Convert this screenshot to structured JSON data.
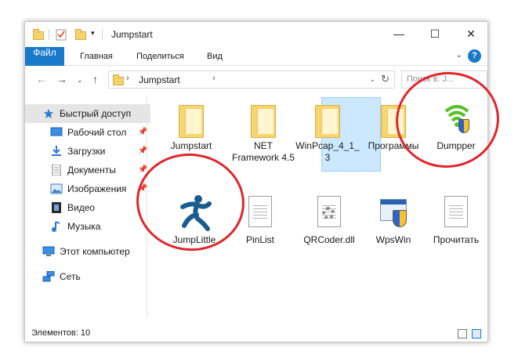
{
  "window": {
    "title": "Jumpstart",
    "controls": {
      "minimize": "—",
      "maximize": "☐",
      "close": "✕"
    }
  },
  "ribbon": {
    "tabs": [
      "Файл",
      "Главная",
      "Поделиться",
      "Вид"
    ],
    "help": "?"
  },
  "navigation": {
    "address_path": "Jumpstart",
    "search_placeholder": "Поиск в: J..."
  },
  "sidebar": {
    "items": [
      {
        "label": "Быстрый доступ",
        "icon": "star-icon",
        "selected": true
      },
      {
        "label": "Рабочий стол",
        "icon": "desktop-icon",
        "pinned": true
      },
      {
        "label": "Загрузки",
        "icon": "download-icon",
        "pinned": true
      },
      {
        "label": "Документы",
        "icon": "documents-icon",
        "pinned": true
      },
      {
        "label": "Изображения",
        "icon": "pictures-icon",
        "pinned": true
      },
      {
        "label": "Видео",
        "icon": "video-icon"
      },
      {
        "label": "Музыка",
        "icon": "music-icon"
      },
      {
        "label": "Этот компьютер",
        "icon": "computer-icon"
      },
      {
        "label": "Сеть",
        "icon": "network-icon"
      }
    ]
  },
  "files": [
    {
      "name": "Jumpstart",
      "type": "folder"
    },
    {
      "name": "NET Framework 4.5",
      "type": "folder"
    },
    {
      "name": "WinPcap_4_1_3",
      "type": "folder"
    },
    {
      "name": "Программы",
      "type": "folder"
    },
    {
      "name": "Dumpper",
      "type": "application",
      "selected": true
    },
    {
      "name": "JumpLittle",
      "type": "application"
    },
    {
      "name": "PinList",
      "type": "document"
    },
    {
      "name": "QRCoder.dll",
      "type": "dll"
    },
    {
      "name": "WpsWin",
      "type": "application"
    },
    {
      "name": "Прочитать",
      "type": "document"
    }
  ],
  "status": {
    "items_count": "Элементов: 10"
  },
  "colors": {
    "accent": "#1979ca",
    "annotation": "#e0262b",
    "wifi_green": "#5bbf2a",
    "jump_blue": "#1a5c8e"
  }
}
